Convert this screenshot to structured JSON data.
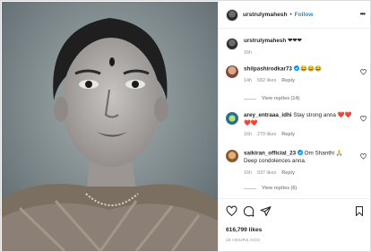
{
  "post": {
    "username": "urstrulymahesh",
    "follow_label": "Follow",
    "caption": "❤❤❤",
    "caption_time": "16h"
  },
  "comments": [
    {
      "user": "shilpashirodkar73",
      "verified": true,
      "text": "😂😂😂",
      "time": "14h",
      "likes": "582 likes",
      "reply": "Reply",
      "view_replies": "View replies (14)"
    },
    {
      "user": "arey_entraaa_idhi",
      "verified": false,
      "text": "Stay strong anna ❤️❤️❤️❤️",
      "time": "16h",
      "likes": "279 likes",
      "reply": "Reply",
      "view_replies": ""
    },
    {
      "user": "saikiran_official_23",
      "verified": true,
      "text": "Om Shanthi 🙏 Deep condolences anna.",
      "time": "16h",
      "likes": "937 likes",
      "reply": "Reply",
      "view_replies": "View replies (6)"
    }
  ],
  "footer": {
    "likes": "616,799 likes",
    "time_ago": "16 HOURS AGO"
  },
  "icons": [
    "more-icon",
    "like-icon",
    "comment-icon",
    "share-icon",
    "save-icon",
    "comment-like-icon",
    "verified-icon"
  ],
  "colors": {
    "accent": "#0095f6",
    "muted": "#8e8e8e",
    "text": "#262626",
    "border": "#dbdbdb"
  }
}
